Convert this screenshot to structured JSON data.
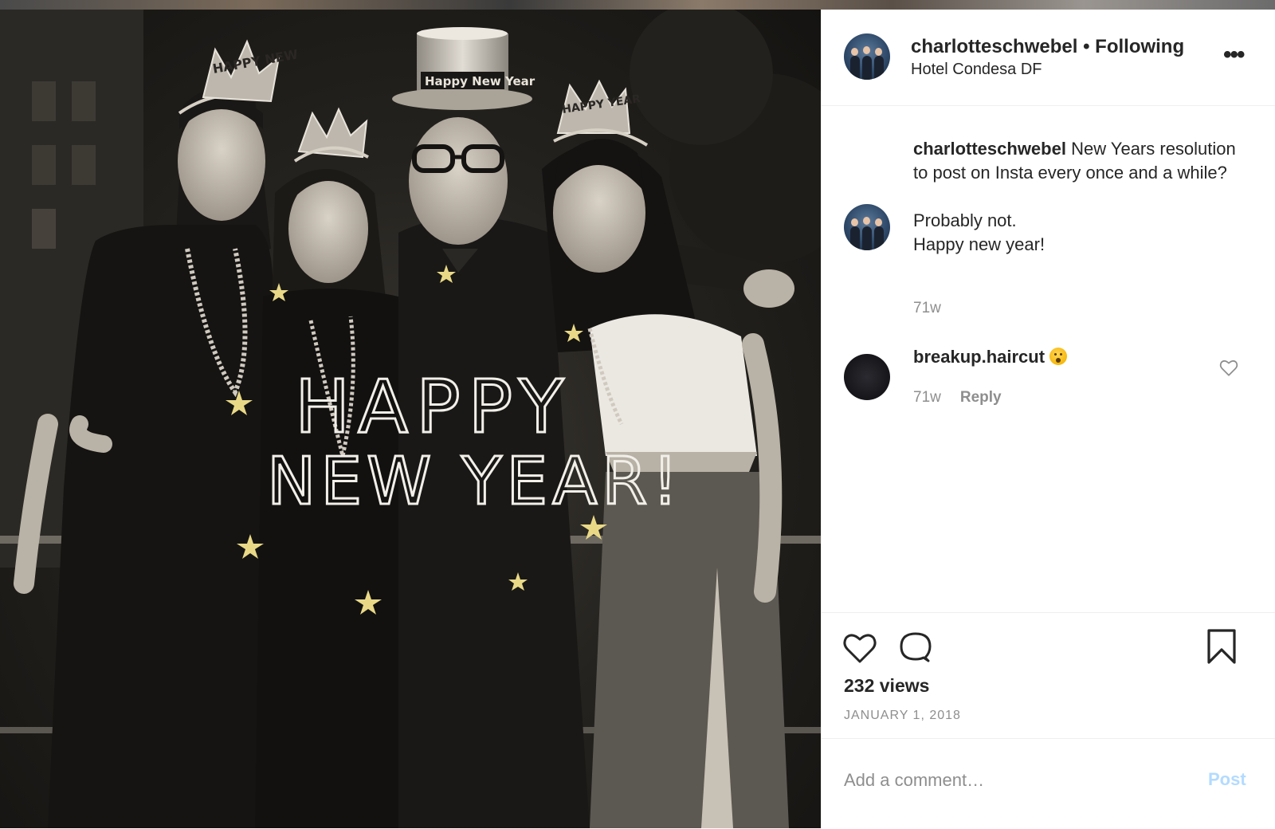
{
  "post": {
    "header": {
      "username": "charlotteschwebel",
      "separator": " • ",
      "follow_status": "Following",
      "location": "Hotel Condesa DF",
      "more_icon": "more-horizontal-icon",
      "more_glyph": "•••"
    },
    "photo": {
      "handwritten_line1": "HAPPY",
      "handwritten_line2": "NEW YEAR!",
      "tiara_left_text": "HAPPY NEW",
      "hat_text": "Happy New Year",
      "tiara_right_text": "HAPPY YEAR"
    },
    "caption": {
      "username": "charlotteschwebel",
      "text_line1": "New Years resolution to post on Insta every once and a while?",
      "text_line2": "Probably not.",
      "text_line3": "Happy new year!",
      "time": "71w"
    },
    "comments": [
      {
        "username": "breakup.haircut",
        "emoji": "hushed-face-emoji",
        "time": "71w",
        "reply_label": "Reply",
        "like_icon": "heart-outline-icon"
      }
    ],
    "actions": {
      "like_icon": "heart-outline-icon",
      "comment_icon": "comment-bubble-icon",
      "save_icon": "bookmark-icon"
    },
    "views": "232 views",
    "date": "JANUARY 1, 2018",
    "add_comment": {
      "placeholder": "Add a comment…",
      "post_label": "Post"
    }
  },
  "colors": {
    "text": "#262626",
    "muted": "#8e8e8e",
    "post_disabled": "#b3dbff",
    "divider": "#efefef"
  }
}
